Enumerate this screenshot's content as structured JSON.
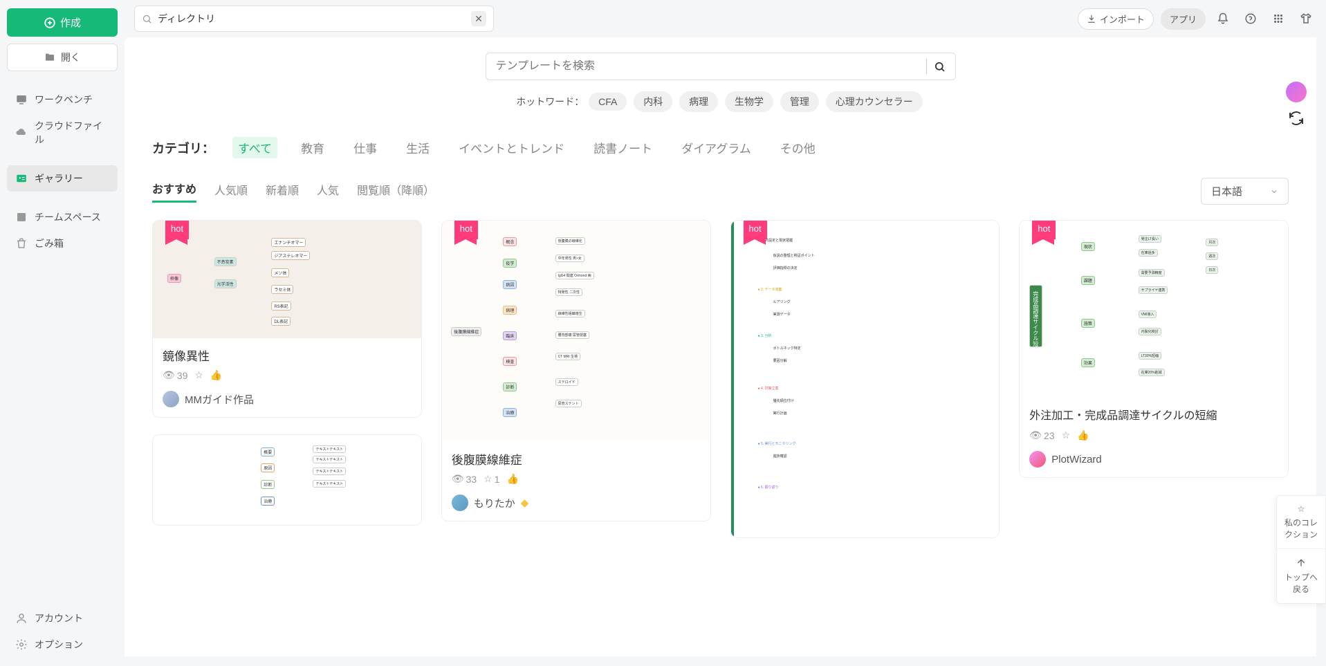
{
  "sidebar": {
    "create": "作成",
    "open": "開く",
    "nav": {
      "workbench": "ワークベンチ",
      "cloud": "クラウドファイル",
      "gallery": "ギャラリー",
      "team": "チームスペース",
      "trash": "ごみ箱"
    },
    "footer": {
      "account": "アカウント",
      "options": "オプション"
    }
  },
  "topbar": {
    "search_value": "ディレクトリ",
    "import": "インポート",
    "apps": "アプリ"
  },
  "content": {
    "template_search_placeholder": "テンプレートを検索",
    "hotwords_label": "ホットワード：",
    "hotwords": [
      "CFA",
      "内科",
      "病理",
      "生物学",
      "管理",
      "心理カウンセラー"
    ],
    "category_label": "カテゴリ：",
    "categories": [
      "すべて",
      "教育",
      "仕事",
      "生活",
      "イベントとトレンド",
      "読書ノート",
      "ダイアグラム",
      "その他"
    ],
    "sorts": [
      "おすすめ",
      "人気順",
      "新着順",
      "人気",
      "閲覧順（降順）"
    ],
    "lang": "日本語"
  },
  "cards": [
    {
      "title": "鏡像異性",
      "views": "39",
      "stars": "",
      "author": "MMガイド作品",
      "hot": true
    },
    {
      "title": "後腹膜線維症",
      "views": "33",
      "stars": "1",
      "author": "もりたか",
      "hot": true
    },
    {
      "title": "",
      "views": "",
      "stars": "",
      "author": "",
      "hot": true
    },
    {
      "title": "外注加工・完成品調達サイクルの短縮",
      "views": "23",
      "stars": "",
      "author": "PlotWizard",
      "hot": true
    }
  ],
  "side": {
    "collection": "私のコレクション",
    "top": "トップへ戻る"
  },
  "hot_label": "hot"
}
